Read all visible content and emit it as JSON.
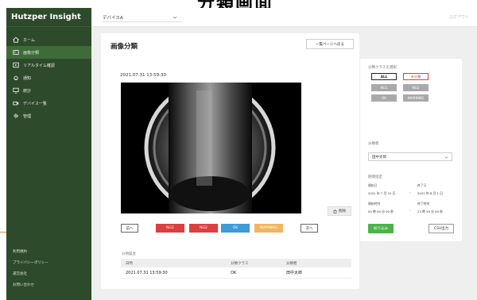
{
  "caption": {
    "text": "分類画面"
  },
  "sidebar": {
    "brand": "Hutzper Insight",
    "items": [
      {
        "label": "ホーム",
        "icon": "home-icon",
        "active": false
      },
      {
        "label": "画像分類",
        "icon": "image-icon",
        "active": true
      },
      {
        "label": "リアルタイム確認",
        "icon": "realtime-icon",
        "active": false
      },
      {
        "label": "通知",
        "icon": "bell-icon",
        "active": false
      },
      {
        "label": "統計",
        "icon": "monitor-icon",
        "active": false
      },
      {
        "label": "デバイス一覧",
        "icon": "camera-icon",
        "active": false
      },
      {
        "label": "管理",
        "icon": "gear-icon",
        "active": false
      }
    ],
    "footer": [
      "利用規約",
      "プライバシーポリシー",
      "運営会社",
      "お問い合わせ"
    ]
  },
  "topbar": {
    "device": "デバイスA",
    "logout": "ログアウト"
  },
  "main": {
    "title": "画像分類",
    "back_button": "一覧ページへ戻る",
    "timestamp": "2021.07.31 13:59:30",
    "delete_button": "削除",
    "prev_button": "前へ",
    "next_button": "次へ",
    "class_buttons": [
      {
        "label": "NG1",
        "color": "#d9403f"
      },
      {
        "label": "NG2",
        "color": "#d9403f"
      },
      {
        "label": "OK",
        "color": "#3f9ad8"
      },
      {
        "label": "WARNING",
        "color": "#f1b460"
      }
    ],
    "history": {
      "title": "分類履歴",
      "headers": [
        "日時",
        "分類クラス",
        "分類者"
      ],
      "rows": [
        [
          "2021.07.31 13:59:30",
          "OK",
          "田中太郎"
        ]
      ]
    }
  },
  "filter": {
    "class_label": "分類クラスを選択",
    "chips": {
      "all": "ALL",
      "unclassified": "未分類",
      "ng1": "NG1",
      "ng2": "NG2",
      "ok": "OK",
      "warning": "WARNING"
    },
    "classifier_label": "分類者",
    "classifier_value": "田中太郎",
    "period_label": "期間指定",
    "start_date_label": "開始日",
    "end_date_label": "終了日",
    "start_time_label": "開始時刻",
    "end_time_label": "終了時刻",
    "start_date": "2021 年 7 月 31 日",
    "end_date": "2021 年 8 月 1 日",
    "start_time": "00 時 00 分 00 秒",
    "end_time": "23 時 59 分 59 秒",
    "apply_button": "絞り込み",
    "csv_button": "CSV出力",
    "accent": "#4bb34b"
  }
}
